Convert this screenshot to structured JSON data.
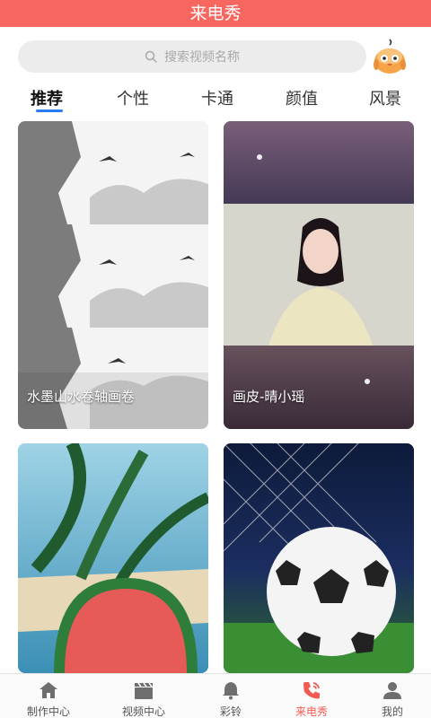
{
  "app": {
    "title": "来电秀"
  },
  "search": {
    "placeholder": "搜索视频名称",
    "icon": "search-icon"
  },
  "profile": {
    "icon": "bird-mascot-avatar"
  },
  "tabs": [
    {
      "label": "推荐",
      "active": true
    },
    {
      "label": "个性",
      "active": false
    },
    {
      "label": "卡通",
      "active": false
    },
    {
      "label": "颜值",
      "active": false
    },
    {
      "label": "风景",
      "active": false
    }
  ],
  "videos": [
    {
      "title": "水墨山水卷轴画卷"
    },
    {
      "title": "画皮-晴小瑶"
    },
    {
      "title": ""
    },
    {
      "title": ""
    }
  ],
  "bottom_nav": [
    {
      "label": "制作中心",
      "icon": "home-icon",
      "active": false
    },
    {
      "label": "视频中心",
      "icon": "clapperboard-icon",
      "active": false
    },
    {
      "label": "彩铃",
      "icon": "bell-icon",
      "active": false
    },
    {
      "label": "来电秀",
      "icon": "phone-icon",
      "active": true
    },
    {
      "label": "我的",
      "icon": "user-icon",
      "active": false
    }
  ],
  "colors": {
    "accent": "#f7665f",
    "tab_indicator": "#2a7cf6",
    "nav_active": "#f25b52"
  }
}
